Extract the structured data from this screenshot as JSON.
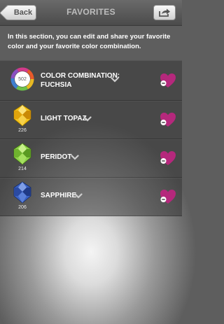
{
  "nav": {
    "back_label": "Back",
    "title": "FAVORITES",
    "share_icon": "share-icon"
  },
  "intro_text": "In this section, you can edit and share your favorite color and your favorite color combination.",
  "colors": {
    "heart": "#b5287c",
    "light_topaz": "#f3c21a",
    "peridot": "#8dd24a",
    "sapphire": "#3a62c4"
  },
  "items": [
    {
      "label_line1": "COLOR COMBINATION:",
      "label_line2": "FUCHSIA",
      "number": "502"
    },
    {
      "label": "LIGHT TOPAZ",
      "number": "226"
    },
    {
      "label": "PERIDOT",
      "number": "214"
    },
    {
      "label": "SAPPHIRE",
      "number": "206"
    }
  ]
}
